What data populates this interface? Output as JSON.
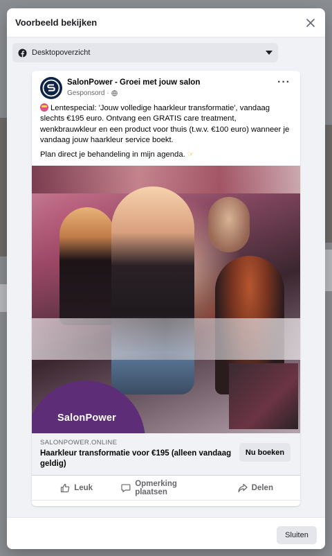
{
  "modal": {
    "title": "Voorbeeld bekijken",
    "close_label": "Sluiten"
  },
  "device_select": {
    "selected": "Desktopoverzicht",
    "icon": "facebook-icon"
  },
  "post": {
    "page_name": "SalonPower - Groei met jouw salon",
    "sponsored": "Gesponsord ·",
    "text_1": "Lentespecial: 'Jouw volledige haarkleur transformatie', vandaag slechts €195 euro. Ontvang een GRATIS care treatment, wenkbrauwkleur en een product voor thuis (t.w.v. €100 euro) wanneer je vandaag jouw haarkleur service boekt.",
    "text_2": "Plan direct je behandeling in mijn agenda.",
    "image_brand": "SalonPower",
    "domain": "SALONPOWER.ONLINE",
    "headline": "Haarkleur transformatie voor €195 (alleen vandaag geldig)",
    "cta": "Nu boeken",
    "actions": {
      "like": "Leuk",
      "comment": "Opmerking plaatsen",
      "share": "Delen"
    }
  },
  "colors": {
    "brand_purple": "#5d2e77",
    "avatar_navy": "#0e2346"
  }
}
